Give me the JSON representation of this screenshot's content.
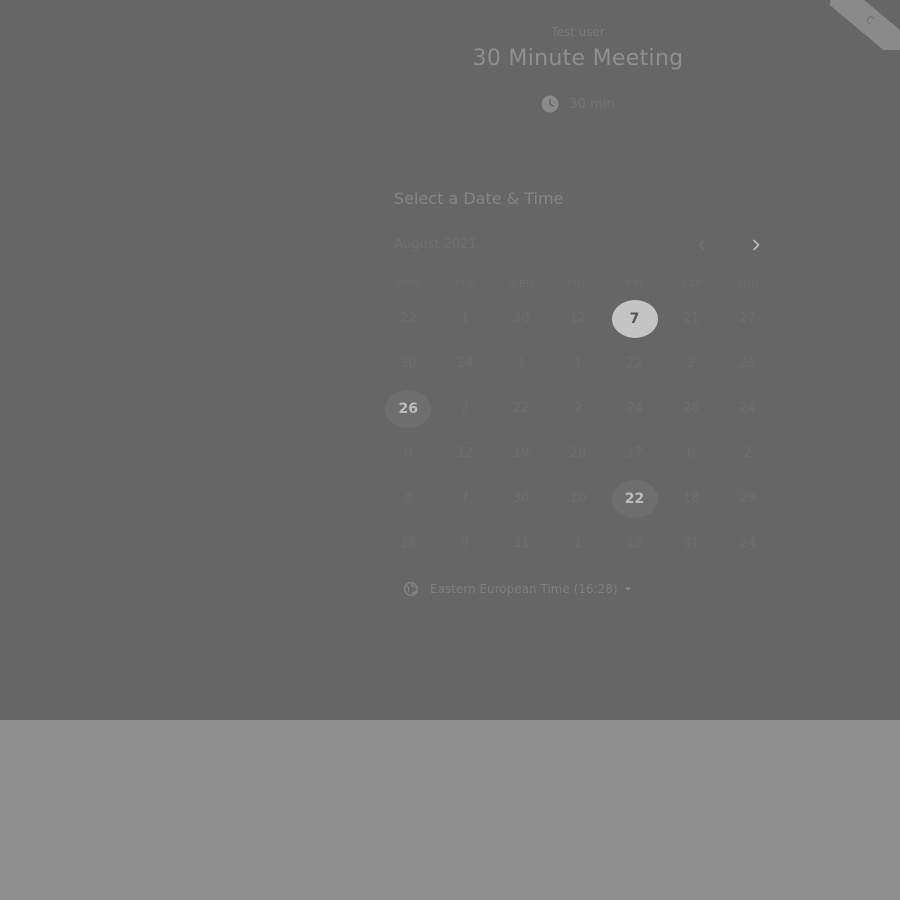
{
  "ribbon": {
    "text": "C"
  },
  "event": {
    "host": "Test user",
    "title": "30 Minute Meeting",
    "duration": "30 min"
  },
  "scheduler": {
    "section_title": "Select a Date & Time",
    "month": "August 2021",
    "weekdays": [
      "MON",
      "TUE",
      "WED",
      "THU",
      "FRI",
      "SAT",
      "SUN"
    ],
    "days": [
      {
        "label": "22",
        "state": "unavailable"
      },
      {
        "label": "1",
        "state": "unavailable"
      },
      {
        "label": "30",
        "state": "unavailable"
      },
      {
        "label": "12",
        "state": "unavailable"
      },
      {
        "label": "7",
        "state": "selected"
      },
      {
        "label": "21",
        "state": "unavailable"
      },
      {
        "label": "27",
        "state": "unavailable"
      },
      {
        "label": "30",
        "state": "unavailable"
      },
      {
        "label": "24",
        "state": "unavailable"
      },
      {
        "label": "1",
        "state": "unavailable"
      },
      {
        "label": "1",
        "state": "unavailable"
      },
      {
        "label": "22",
        "state": "unavailable"
      },
      {
        "label": "2",
        "state": "unavailable"
      },
      {
        "label": "21",
        "state": "unavailable"
      },
      {
        "label": "26",
        "state": "available"
      },
      {
        "label": "2",
        "state": "unavailable"
      },
      {
        "label": "22",
        "state": "unavailable"
      },
      {
        "label": "2",
        "state": "unavailable"
      },
      {
        "label": "24",
        "state": "unavailable"
      },
      {
        "label": "28",
        "state": "unavailable"
      },
      {
        "label": "24",
        "state": "unavailable"
      },
      {
        "label": "0",
        "state": "unavailable"
      },
      {
        "label": "12",
        "state": "unavailable"
      },
      {
        "label": "19",
        "state": "unavailable"
      },
      {
        "label": "28",
        "state": "unavailable"
      },
      {
        "label": "17",
        "state": "unavailable"
      },
      {
        "label": "0",
        "state": "unavailable"
      },
      {
        "label": "2",
        "state": "unavailable"
      },
      {
        "label": "8",
        "state": "unavailable"
      },
      {
        "label": "7",
        "state": "unavailable"
      },
      {
        "label": "30",
        "state": "unavailable"
      },
      {
        "label": "10",
        "state": "unavailable"
      },
      {
        "label": "22",
        "state": "available"
      },
      {
        "label": "18",
        "state": "unavailable"
      },
      {
        "label": "29",
        "state": "unavailable"
      },
      {
        "label": "28",
        "state": "unavailable"
      },
      {
        "label": "9",
        "state": "unavailable"
      },
      {
        "label": "31",
        "state": "unavailable"
      },
      {
        "label": "1",
        "state": "unavailable"
      },
      {
        "label": "13",
        "state": "unavailable"
      },
      {
        "label": "31",
        "state": "unavailable"
      },
      {
        "label": "24",
        "state": "unavailable"
      }
    ],
    "timezone": "Eastern European Time (16:28)"
  },
  "colors": {
    "panel_bg": "#666666",
    "page_bg": "#8f8f8f",
    "selected_day_bg": "#c4c4c4"
  },
  "icons": {
    "duration": "clock-icon",
    "timezone": "globe-icon",
    "prev": "chevron-left-icon",
    "next": "chevron-right-icon",
    "dropdown": "caret-down-icon"
  }
}
